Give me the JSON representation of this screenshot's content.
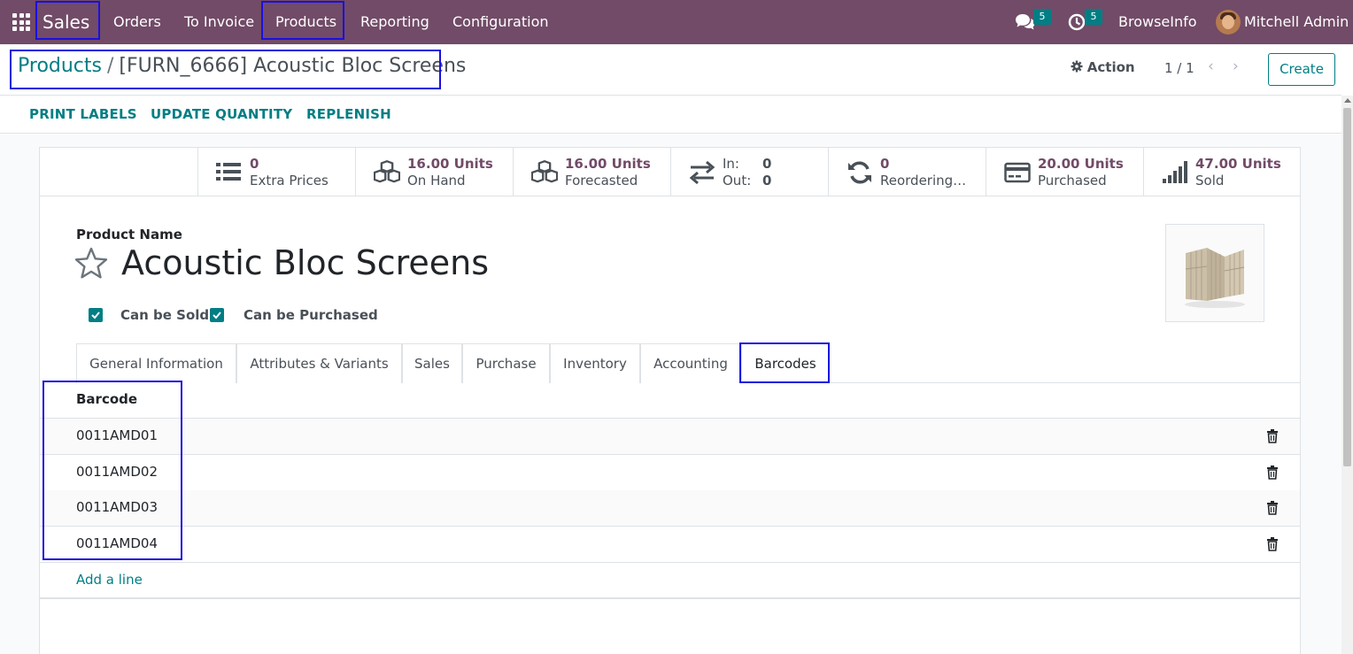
{
  "navbar": {
    "app_name": "Sales",
    "menu": [
      "Orders",
      "To Invoice",
      "Products",
      "Reporting",
      "Configuration"
    ],
    "messages_count": "5",
    "activities_count": "5",
    "company": "BrowseInfo",
    "user": "Mitchell Admin",
    "bg_color": "#714B67"
  },
  "breadcrumb": {
    "parent": "Products",
    "separator": "/",
    "current": "[FURN_6666] Acoustic Bloc Screens"
  },
  "control": {
    "action_label": "Action",
    "pager": "1 / 1",
    "create_label": "Create"
  },
  "action_buttons": [
    "PRINT LABELS",
    "UPDATE QUANTITY",
    "REPLENISH"
  ],
  "smart_buttons": [
    {
      "value": "0",
      "label": "Extra Prices",
      "icon": "list-icon"
    },
    {
      "value": "16.00 Units",
      "label": "On Hand",
      "icon": "cubes-icon"
    },
    {
      "value": "16.00 Units",
      "label": "Forecasted",
      "icon": "cubes-icon"
    },
    {
      "in_label": "In:",
      "in_value": "0",
      "out_label": "Out:",
      "out_value": "0",
      "icon": "exchange-icon"
    },
    {
      "value": "0",
      "label": "Reordering…",
      "icon": "refresh-icon"
    },
    {
      "value": "20.00 Units",
      "label": "Purchased",
      "icon": "credit-card-icon"
    },
    {
      "value": "47.00 Units",
      "label": "Sold",
      "icon": "signal-icon"
    }
  ],
  "product": {
    "name_label": "Product Name",
    "name": "Acoustic Bloc Screens",
    "can_be_sold_label": "Can be Sold",
    "can_be_sold": true,
    "can_be_purchased_label": "Can be Purchased",
    "can_be_purchased": true
  },
  "tabs": [
    "General Information",
    "Attributes & Variants",
    "Sales",
    "Purchase",
    "Inventory",
    "Accounting",
    "Barcodes"
  ],
  "active_tab": "Barcodes",
  "barcodes": {
    "column": "Barcode",
    "rows": [
      "0011AMD01",
      "0011AMD02",
      "0011AMD03",
      "0011AMD04"
    ],
    "add_line": "Add a line"
  },
  "colors": {
    "accent": "#017e84",
    "primary": "#714B67",
    "highlight": "#1a0fe0"
  }
}
